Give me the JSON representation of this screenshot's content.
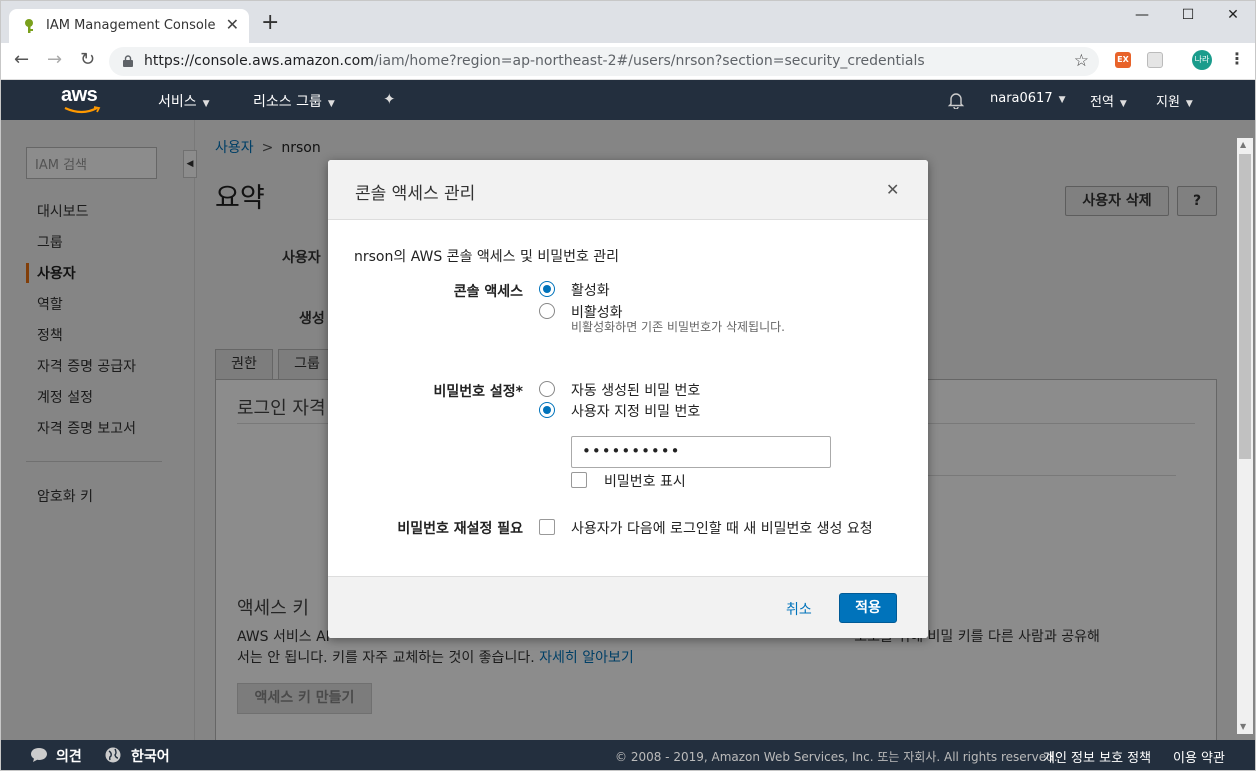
{
  "browser": {
    "tab_title": "IAM Management Console",
    "url_host": "https://console.aws.amazon.com",
    "url_path": "/iam/home?region=ap-northeast-2#/users/nrson?section=security_credentials",
    "profile_initials": "나라",
    "ext_label": "EX"
  },
  "aws_nav": {
    "logo": "aws",
    "services": "서비스",
    "resource_groups": "리소스 그룹",
    "account": "nara0617",
    "region": "전역",
    "support": "지원"
  },
  "sidebar": {
    "search_placeholder": "IAM 검색",
    "items": [
      "대시보드",
      "그룹",
      "사용자",
      "역할",
      "정책",
      "자격 증명 공급자",
      "계정 설정",
      "자격 증명 보고서"
    ],
    "active_index": 2,
    "encryption_keys": "암호화 키"
  },
  "main": {
    "breadcrumb_root": "사용자",
    "breadcrumb_current": "nrson",
    "title": "요약",
    "delete_user": "사용자 삭제",
    "help": "?",
    "summary_user_label": "사용자",
    "summary_created_label": "생성",
    "tabs": [
      "권한",
      "그룹"
    ],
    "login_heading": "로그인 자격",
    "access_key_heading": "액세스 키",
    "access_key_text_1": "AWS 서비스 AI",
    "access_key_text_2": "보호를 위해 비밀 키를 다른 사람과 공유해",
    "access_key_text_3": "서는 안 됩니다. 키를 자주 교체하는 것이 좋습니다.",
    "learn_more": "자세히 알아보기",
    "create_access_key": "액세스 키 만들기"
  },
  "modal": {
    "title": "콘솔 액세스 관리",
    "description": "nrson의 AWS 콘솔 액세스 및 비밀번호 관리",
    "console_access_label": "콘솔 액세스",
    "enable": "활성화",
    "disable": "비활성화",
    "disable_hint": "비활성화하면 기존 비밀번호가 삭제됩니다.",
    "password_label": "비밀번호 설정*",
    "auto_password": "자동 생성된 비밀 번호",
    "custom_password": "사용자 지정 비밀 번호",
    "password_value": "••••••••••",
    "show_password": "비밀번호 표시",
    "reset_label": "비밀번호 재설정 필요",
    "reset_text": "사용자가 다음에 로그인할 때 새 비밀번호 생성 요청",
    "cancel": "취소",
    "apply": "적용"
  },
  "footer": {
    "feedback": "의견",
    "language": "한국어",
    "copyright": "© 2008 - 2019, Amazon Web Services, Inc. 또는 자회사. All rights reserved.",
    "privacy": "개인 정보 보호 정책",
    "terms": "이용 약관"
  },
  "colors": {
    "aws_nav": "#232f3e",
    "primary": "#0073bb",
    "accent": "#ec7211"
  }
}
